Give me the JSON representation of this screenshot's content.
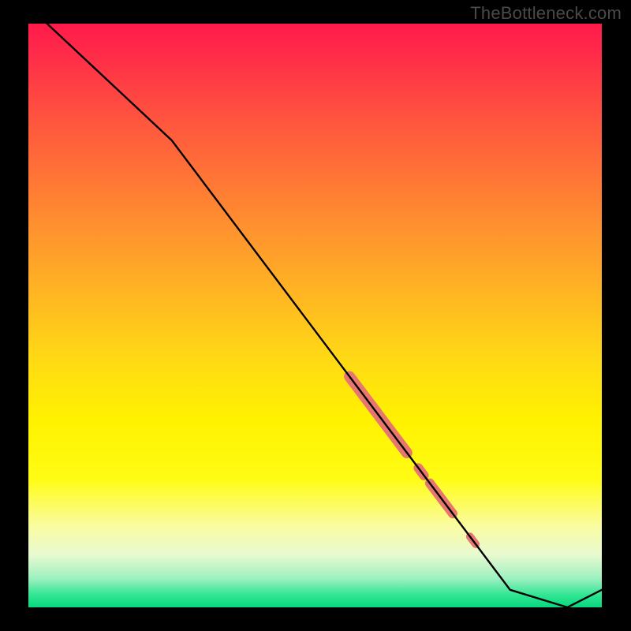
{
  "watermark": "TheBottleneck.com",
  "chart_data": {
    "type": "line",
    "title": "",
    "xlabel": "",
    "ylabel": "",
    "xlim": [
      0,
      100
    ],
    "ylim": [
      0,
      100
    ],
    "series": [
      {
        "name": "bottleneck-curve",
        "x": [
          0,
          25,
          84,
          94,
          100
        ],
        "values": [
          103,
          80,
          3,
          0,
          3
        ],
        "color": "#000000"
      }
    ],
    "markers": [
      {
        "name": "thick-segment-1",
        "x_start": 56,
        "x_end": 66,
        "width": 14,
        "color": "#e87670"
      },
      {
        "name": "dot-1",
        "x_start": 68,
        "x_end": 69,
        "width": 12,
        "color": "#e87670"
      },
      {
        "name": "thick-segment-2",
        "x_start": 70,
        "x_end": 74,
        "width": 12,
        "color": "#e87670"
      },
      {
        "name": "dot-2",
        "x_start": 77,
        "x_end": 78,
        "width": 10,
        "color": "#e87670"
      }
    ],
    "background": {
      "type": "vertical-gradient",
      "stops": [
        {
          "pos": 0,
          "color": "#ff1a4a"
        },
        {
          "pos": 50,
          "color": "#ffdb14"
        },
        {
          "pos": 100,
          "color": "#07d77e"
        }
      ]
    }
  }
}
